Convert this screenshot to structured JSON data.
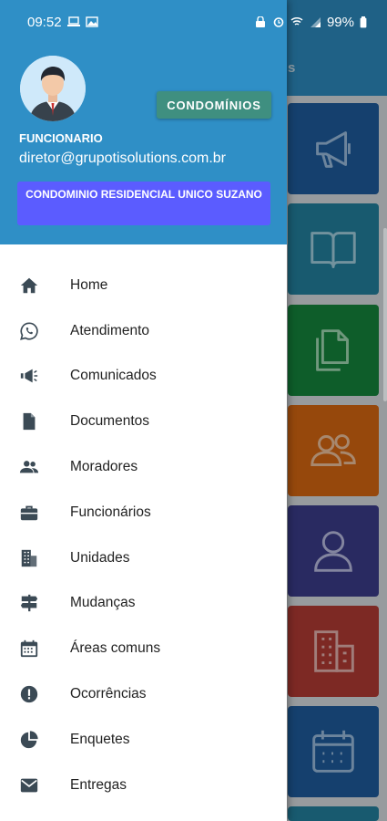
{
  "status_bar": {
    "time": "09:52",
    "battery": "99%",
    "icons": [
      "laptop-icon",
      "image-icon",
      "lock-icon",
      "alarm-icon",
      "wifi-icon",
      "signal-icon",
      "battery-icon"
    ]
  },
  "background": {
    "appbar_title_fragment": "s",
    "tiles": [
      {
        "icon": "megaphone-icon",
        "color": "#1f5fa3"
      },
      {
        "icon": "book-icon",
        "color": "#2485a4"
      },
      {
        "icon": "documents-icon",
        "color": "#15893f"
      },
      {
        "icon": "group-icon",
        "color": "#de6a13"
      },
      {
        "icon": "person-icon",
        "color": "#3d3f8f"
      },
      {
        "icon": "building-icon",
        "color": "#b83d36"
      },
      {
        "icon": "calendar-icon",
        "color": "#1f5fa3"
      }
    ]
  },
  "drawer": {
    "condominios_button": "CONDOMÍNIOS",
    "user_role": "FUNCIONARIO",
    "user_email": "diretor@grupotisolutions.com.br",
    "condominium_name": "CONDOMINIO RESIDENCIAL UNICO SUZANO",
    "menu": [
      {
        "label": "Home",
        "icon": "home-icon"
      },
      {
        "label": "Atendimento",
        "icon": "whatsapp-icon"
      },
      {
        "label": "Comunicados",
        "icon": "megaphone-icon"
      },
      {
        "label": "Documentos",
        "icon": "document-icon"
      },
      {
        "label": "Moradores",
        "icon": "people-icon"
      },
      {
        "label": "Funcionários",
        "icon": "briefcase-icon"
      },
      {
        "label": "Unidades",
        "icon": "building-icon"
      },
      {
        "label": "Mudanças",
        "icon": "signpost-icon"
      },
      {
        "label": "Áreas comuns",
        "icon": "calendar-icon"
      },
      {
        "label": "Ocorrências",
        "icon": "alert-icon"
      },
      {
        "label": "Enquetes",
        "icon": "pie-chart-icon"
      },
      {
        "label": "Entregas",
        "icon": "mail-icon"
      }
    ]
  },
  "colors": {
    "primary": "#2f8fc6",
    "condominios_button": "#3f8f80",
    "condominium_badge": "#5b5cff",
    "menu_icon": "#3b4a55"
  }
}
